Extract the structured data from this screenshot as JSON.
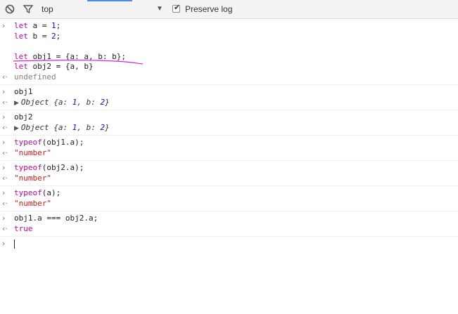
{
  "toolbar": {
    "context": "top",
    "preserve_log_label": "Preserve log",
    "preserve_log_checked": "✔"
  },
  "console": {
    "entries": [
      {
        "input": [
          "let a = 1;",
          "let b = 2;",
          "",
          "let obj1 = {a: a, b: b};",
          "let obj2 = {a, b}"
        ],
        "output": "undefined"
      },
      {
        "input": [
          "obj1"
        ],
        "output": "Object {a: 1, b: 2}"
      },
      {
        "input": [
          "obj2"
        ],
        "output": "Object {a: 1, b: 2}"
      },
      {
        "input": [
          "typeof(obj1.a);"
        ],
        "output": "\"number\""
      },
      {
        "input": [
          "typeof(obj2.a);"
        ],
        "output": "\"number\""
      },
      {
        "input": [
          "typeof(a);"
        ],
        "output": "\"number\""
      },
      {
        "input": [
          "obj1.a === obj2.a;"
        ],
        "output": "true"
      }
    ]
  },
  "icons": {
    "clear": "clear-console-icon",
    "filter": "filter-icon",
    "input_caret": "chevron-right-icon",
    "output_caret": "return-arrow-icon",
    "expand": "expand-triangle-icon"
  },
  "colors": {
    "keyword": "#aa0d91",
    "number": "#1c00cf",
    "string": "#c41a16",
    "annotation": "#e020e0",
    "prompt": "#2a6fdb"
  }
}
